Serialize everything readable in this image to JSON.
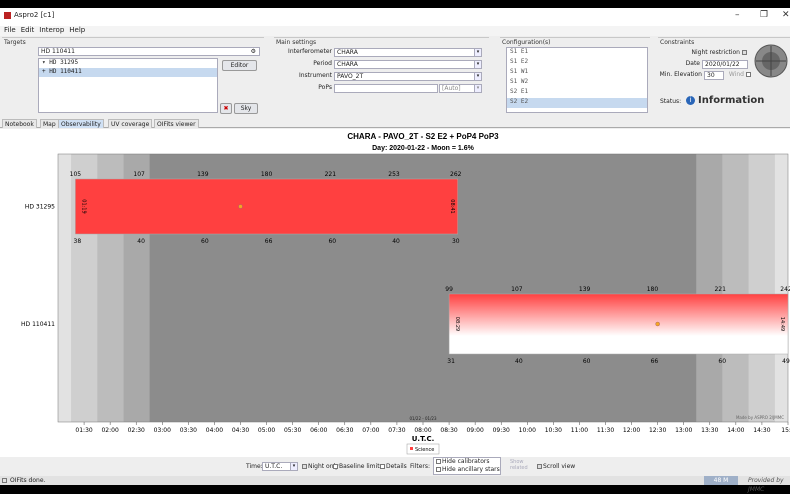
{
  "window": {
    "title": "Aspro2 [c1]",
    "minimize": "–",
    "maximize": "❐",
    "close": "✕"
  },
  "menu": [
    "File",
    "Edit",
    "Interop",
    "Help"
  ],
  "targets": {
    "label": "Targets",
    "search_value": "HD 110411",
    "list": [
      "HD 31295",
      "HD 110411"
    ],
    "editor": "Editor",
    "sky": "Sky"
  },
  "main_settings": {
    "label": "Main settings",
    "interferometer_label": "Interferometer",
    "interferometer": "CHARA",
    "period_label": "Period",
    "period": "CHARA",
    "instrument_label": "Instrument",
    "instrument": "PAVO_2T",
    "pops_label": "PoPs",
    "pops": "",
    "pops_auto": "[Auto]"
  },
  "configuration": {
    "label": "Configuration(s)",
    "items": [
      "S1 E1",
      "S1 E2",
      "S1 W1",
      "S1 W2",
      "S2 E1",
      "S2 E2"
    ],
    "selected": "S2 E2"
  },
  "constraints": {
    "label": "Constraints",
    "night_label": "Night restriction",
    "date_label": "Date",
    "date": "2020/01/22",
    "minelev_label": "Min. Elevation",
    "minelev": "30",
    "wind_label": "Wind"
  },
  "status": {
    "label": "Status:",
    "value": "Information"
  },
  "tabs": [
    "Notebook",
    "Map",
    "Observability",
    "UV coverage",
    "OIFits viewer"
  ],
  "active_tab": "Observability",
  "chart_data": {
    "type": "gantt",
    "title": "CHARA - PAVO_2T - S2 E2 + PoP4 PoP3",
    "subtitle": "Day: 2020-01-22 - Moon = 1.6%",
    "xlabel": "U.T.C.",
    "xticks": [
      "01:30",
      "02:00",
      "02:30",
      "03:00",
      "03:30",
      "04:00",
      "04:30",
      "05:00",
      "05:30",
      "06:00",
      "06:30",
      "07:00",
      "07:30",
      "08:00",
      "08:30",
      "09:00",
      "09:30",
      "10:00",
      "10:30",
      "11:00",
      "11:30",
      "12:00",
      "12:30",
      "13:00",
      "13:30",
      "14:00",
      "14:30",
      "15:0"
    ],
    "xrange": [
      "01:00",
      "15:00"
    ],
    "date_marker": "01/22 - 01/23",
    "credit": "Made by ASPRO 2/JMMC",
    "targets": [
      {
        "name": "HD 31295",
        "start": "01:20",
        "end": "08:40",
        "transit": "04:30",
        "start_label": "01:19",
        "end_label": "08:41",
        "top_ticks": [
          "105",
          "107",
          "139",
          "180",
          "221",
          "253",
          "262"
        ],
        "bottom_ticks": [
          "38",
          "40",
          "60",
          "66",
          "60",
          "40",
          "30"
        ],
        "color": "#ff4040"
      },
      {
        "name": "HD 110411",
        "start": "08:30",
        "end": "15:00",
        "transit": "12:30",
        "start_label": "08:29",
        "end_label": "14:49",
        "top_ticks": [
          "99",
          "107",
          "139",
          "180",
          "221",
          "242"
        ],
        "bottom_ticks": [
          "31",
          "40",
          "60",
          "66",
          "60",
          "49"
        ],
        "color": "#ff4040"
      }
    ],
    "legend": "Science"
  },
  "bottom": {
    "time_label": "Time:",
    "time_value": "U.T.C.",
    "night_only": "Night only",
    "baseline_limits": "Baseline limits",
    "details": "Details",
    "filters_label": "Filters:",
    "hide_calibrators": "Hide calibrators",
    "hide_ancillary": "Hide ancillary stars",
    "show_related": "Show related",
    "scroll_view": "Scroll view"
  },
  "statusbar": {
    "message": "OIFits done.",
    "memory": "48 M",
    "provided": "Provided by JMMC"
  }
}
